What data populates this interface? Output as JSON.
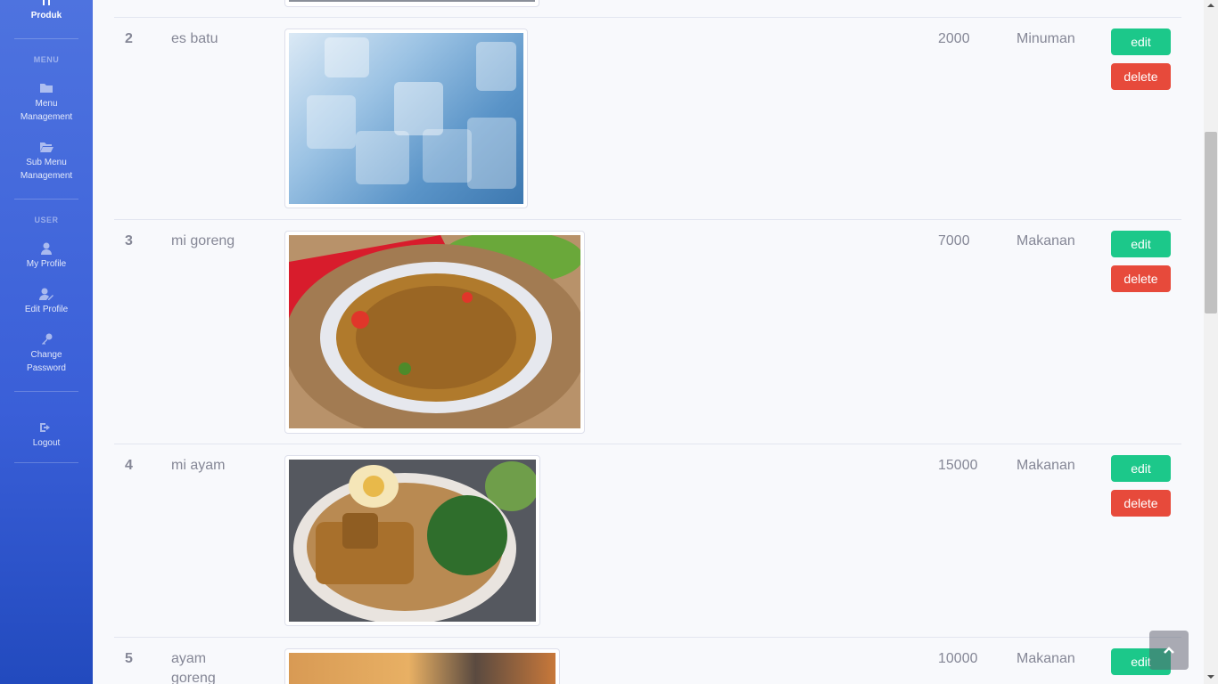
{
  "sidebar": {
    "brand_label": "Produk",
    "headings": {
      "menu": "MENU",
      "user": "USER"
    },
    "items": [
      {
        "label_line1": "Menu",
        "label_line2": "Management",
        "icon": "folder-icon"
      },
      {
        "label_line1": "Sub Menu",
        "label_line2": "Management",
        "icon": "folder-open-icon"
      },
      {
        "label_line1": "My Profile",
        "label_line2": "",
        "icon": "user-icon"
      },
      {
        "label_line1": "Edit Profile",
        "label_line2": "",
        "icon": "user-edit-icon"
      },
      {
        "label_line1": "Change",
        "label_line2": "Password",
        "icon": "key-icon"
      },
      {
        "label_line1": "Logout",
        "label_line2": "",
        "icon": "sign-out-icon"
      }
    ]
  },
  "table": {
    "rows": [
      {
        "no": "2",
        "name": "es batu",
        "image": "ice-cubes-photo",
        "price": "2000",
        "category": "Minuman",
        "edit_label": "edit",
        "delete_label": "delete"
      },
      {
        "no": "3",
        "name": "mi goreng",
        "image": "fried-noodles-photo",
        "price": "7000",
        "category": "Makanan",
        "edit_label": "edit",
        "delete_label": "delete"
      },
      {
        "no": "4",
        "name": "mi ayam",
        "image": "chicken-noodles-photo",
        "price": "15000",
        "category": "Makanan",
        "edit_label": "edit",
        "delete_label": "delete"
      },
      {
        "no": "5",
        "name_line1": "ayam",
        "name_line2": "goreng",
        "image": "fried-chicken-photo",
        "price": "10000",
        "category": "Makanan",
        "edit_label": "edit"
      }
    ]
  },
  "colors": {
    "sidebar": "#4e73df",
    "edit": "#1cc88a",
    "delete": "#e74a3b"
  }
}
